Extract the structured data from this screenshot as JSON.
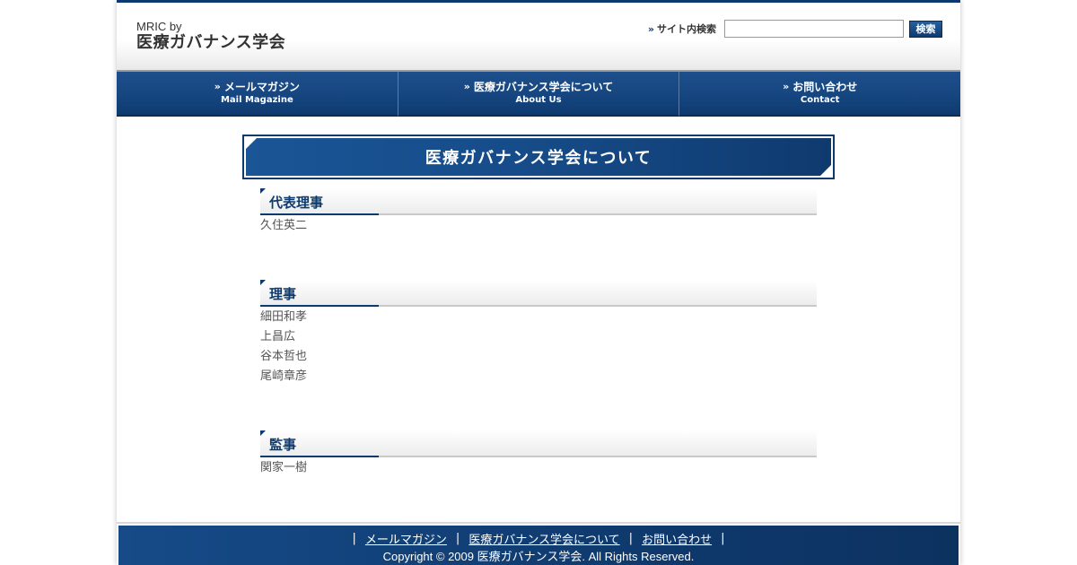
{
  "header": {
    "logo_small": "MRIC by",
    "logo_main": "医療ガバナンス学会",
    "search_label": "サイト内検索",
    "search_value": "",
    "search_button": "検索"
  },
  "nav": [
    {
      "label_jp": "メールマガジン",
      "label_en": "Mail Magazine"
    },
    {
      "label_jp": "医療ガバナンス学会について",
      "label_en": "About Us"
    },
    {
      "label_jp": "お問い合わせ",
      "label_en": "Contact"
    }
  ],
  "main": {
    "page_title": "医療ガバナンス学会について",
    "sections": [
      {
        "title": "代表理事",
        "members": [
          "久住英二"
        ]
      },
      {
        "title": "理事",
        "members": [
          "細田和孝",
          "上昌広",
          "谷本哲也",
          "尾崎章彦"
        ]
      },
      {
        "title": "監事",
        "members": [
          "関家一樹"
        ]
      }
    ]
  },
  "footer": {
    "links": [
      "メールマガジン",
      "医療ガバナンス学会について",
      "お問い合わせ"
    ],
    "copyright": "Copyright © 2009 医療ガバナンス学会. All Rights Reserved."
  },
  "colors": {
    "brand": "#0d3a6e",
    "accent": "#164b88"
  },
  "icons": {
    "nav_bullet": "chevron-right-icon",
    "search_bullet": "chevron-right-icon"
  }
}
